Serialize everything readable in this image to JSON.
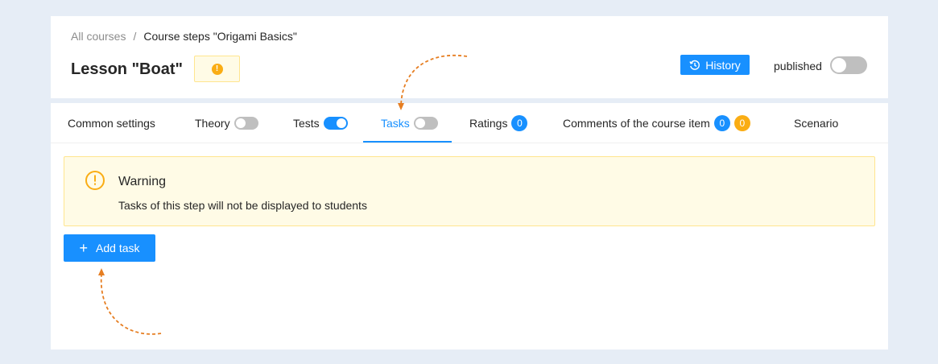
{
  "breadcrumb": {
    "root": "All courses",
    "separator": "/",
    "current": "Course steps \"Origami Basics\""
  },
  "lesson": {
    "title": "Lesson \"Boat\"",
    "badge_icon": "!"
  },
  "history": {
    "label": "History",
    "icon": "history-icon"
  },
  "published": {
    "label": "published",
    "enabled": false
  },
  "tabs": [
    {
      "label": "Common settings"
    },
    {
      "label": "Theory",
      "toggle": false
    },
    {
      "label": "Tests",
      "toggle": true
    },
    {
      "label": "Tasks",
      "toggle": false,
      "active": true
    },
    {
      "label": "Ratings",
      "badge": "0"
    },
    {
      "label": "Comments of the course item",
      "badge": "0",
      "badge2": "0"
    },
    {
      "label": "Scenario"
    }
  ],
  "alert": {
    "title": "Warning",
    "description": "Tasks of this step will not be displayed to students",
    "icon": "!"
  },
  "add_task": {
    "label": "Add task",
    "icon": "+"
  },
  "colors": {
    "accent": "#1890ff",
    "warning": "#faad14",
    "warning_bg": "#fffbe6",
    "annotation_arrow": "#e67e22"
  }
}
